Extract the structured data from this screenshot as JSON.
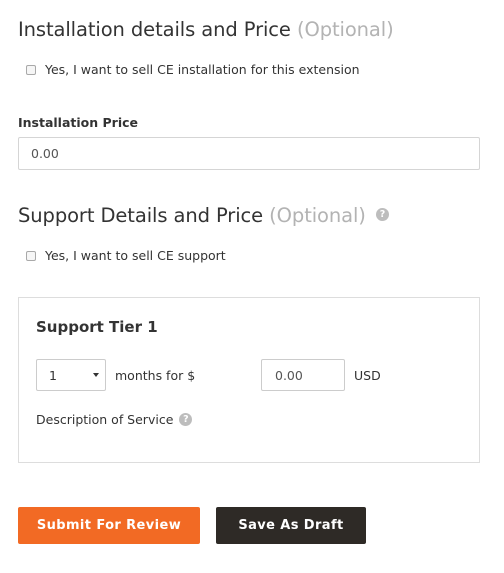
{
  "installation": {
    "title": "Installation details and Price",
    "optional": "(Optional)",
    "checkbox_label": "Yes, I want to sell CE installation for this extension",
    "checkbox_checked": false,
    "price_label": "Installation Price",
    "price_value": "0.00"
  },
  "support": {
    "title": "Support Details and Price",
    "optional": "(Optional)",
    "help_icon": "?",
    "checkbox_label": "Yes, I want to sell CE support",
    "checkbox_checked": false
  },
  "tier": {
    "title": "Support Tier 1",
    "months_value": "1",
    "months_label": "months for $",
    "price_value": "0.00",
    "currency": "USD",
    "description_label": "Description of Service",
    "help_icon": "?"
  },
  "actions": {
    "submit_label": "Submit For Review",
    "draft_label": "Save As Draft"
  },
  "colors": {
    "submit": "#f26a24",
    "draft": "#2e2a26",
    "optional_text": "#b3b3b3"
  }
}
